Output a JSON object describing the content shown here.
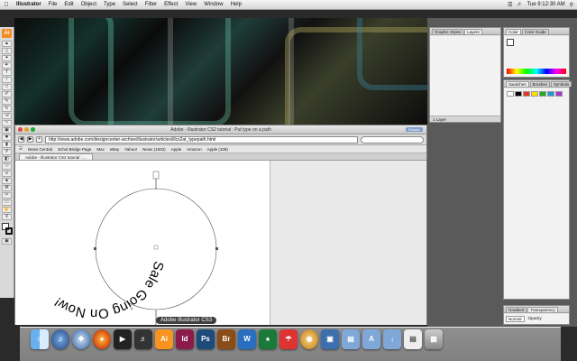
{
  "menubar": {
    "apple": "",
    "items": [
      "Illustrator",
      "File",
      "Edit",
      "Object",
      "Type",
      "Select",
      "Filter",
      "Effect",
      "View",
      "Window",
      "Help"
    ],
    "clock": "Tue 9:12:30 AM"
  },
  "toolbox": {
    "app_badge": "Ai"
  },
  "browser": {
    "title": "Adobe - Illustrator CS2 tutorial : Put type on a path",
    "reader_label": "Reader",
    "url": "http://www.adobe.com/designcenter-archive/illustrator/articles/illcs2at_typepath.html",
    "bookmarks": [
      "News Central",
      "Schol Bridge Page",
      "Mac",
      "eBay",
      "Yahoo!",
      "News (1932)",
      "Apple",
      "Amazon",
      "Apple (108)"
    ],
    "tab": "Adobe - Illustrator CS2 tutorial : ..."
  },
  "artboard": {
    "path_text": "Sale Going On Now!"
  },
  "panels": {
    "graphic_styles": {
      "tabs": [
        "Graphic Styles",
        "Layers"
      ],
      "footer": "1 Layer"
    },
    "color": {
      "tabs": [
        "Color",
        "Color Guide"
      ],
      "none_label": "None"
    },
    "swatches": {
      "tabs": [
        "Swatches",
        "Brushes",
        "Symbols"
      ]
    },
    "gradient": {
      "tabs": [
        "Gradient",
        "Transparency"
      ],
      "mode": "Normal",
      "opacity_label": "Opacity"
    }
  },
  "dock": {
    "tooltip": "Adobe Illustrator CS3",
    "apps": [
      "Finder",
      "iTunes",
      "Safari",
      "Firefox",
      "Front Row",
      "GarageBand",
      "Ai",
      "Id",
      "Ps",
      "Br",
      "Word",
      "Dashboard",
      "Preview",
      "Automator",
      "iPhoto",
      "Folder",
      "Applications",
      "Downloads",
      "Trash"
    ]
  }
}
